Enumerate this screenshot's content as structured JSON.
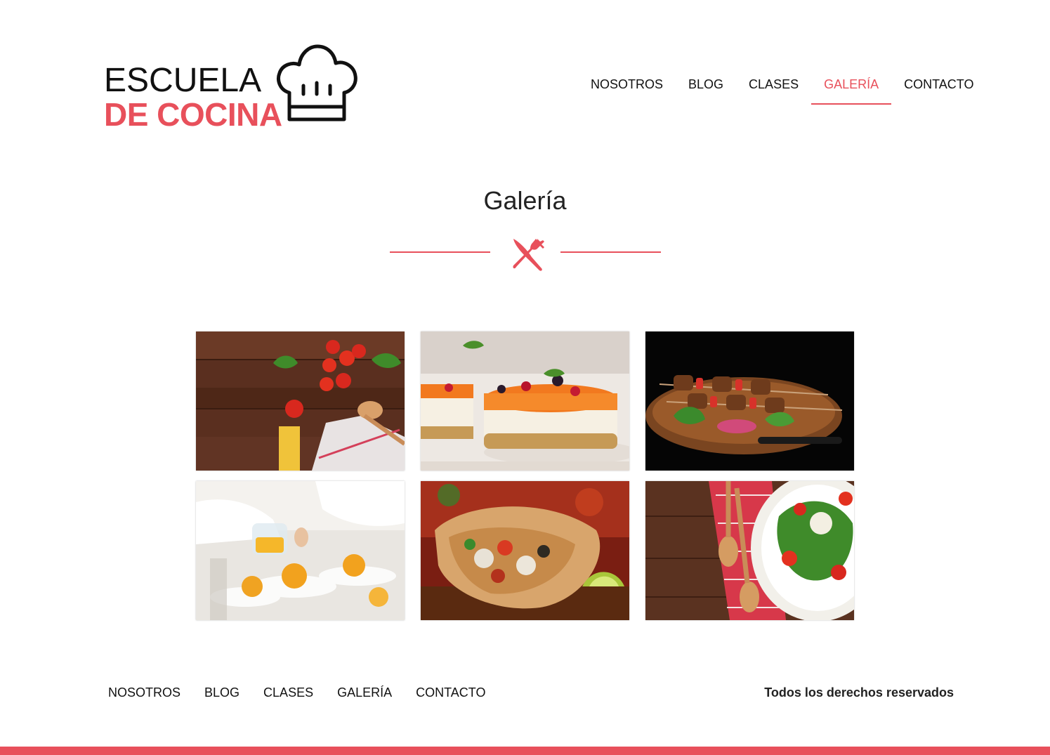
{
  "logo": {
    "line1": "ESCUELA",
    "line2": "DE COCINA",
    "icon": "chef-hat-icon"
  },
  "nav": {
    "items": [
      {
        "label": "NOSOTROS",
        "active": false
      },
      {
        "label": "BLOG",
        "active": false
      },
      {
        "label": "CLASES",
        "active": false
      },
      {
        "label": "GALERÍA",
        "active": true
      },
      {
        "label": "CONTACTO",
        "active": false
      }
    ]
  },
  "main": {
    "title": "Galería",
    "divider_icon": "cutlery-icon"
  },
  "gallery": {
    "items": [
      {
        "name": "tomatoes-pasta-photo"
      },
      {
        "name": "cheesecake-photo"
      },
      {
        "name": "skewers-photo"
      },
      {
        "name": "chef-plating-photo"
      },
      {
        "name": "burrito-photo"
      },
      {
        "name": "salad-photo"
      }
    ]
  },
  "footer": {
    "items": [
      "NOSOTROS",
      "BLOG",
      "CLASES",
      "GALERÍA",
      "CONTACTO"
    ],
    "rights": "Todos los derechos reservados"
  },
  "colors": {
    "accent": "#e8505b",
    "text": "#111111",
    "background": "#ffffff"
  }
}
